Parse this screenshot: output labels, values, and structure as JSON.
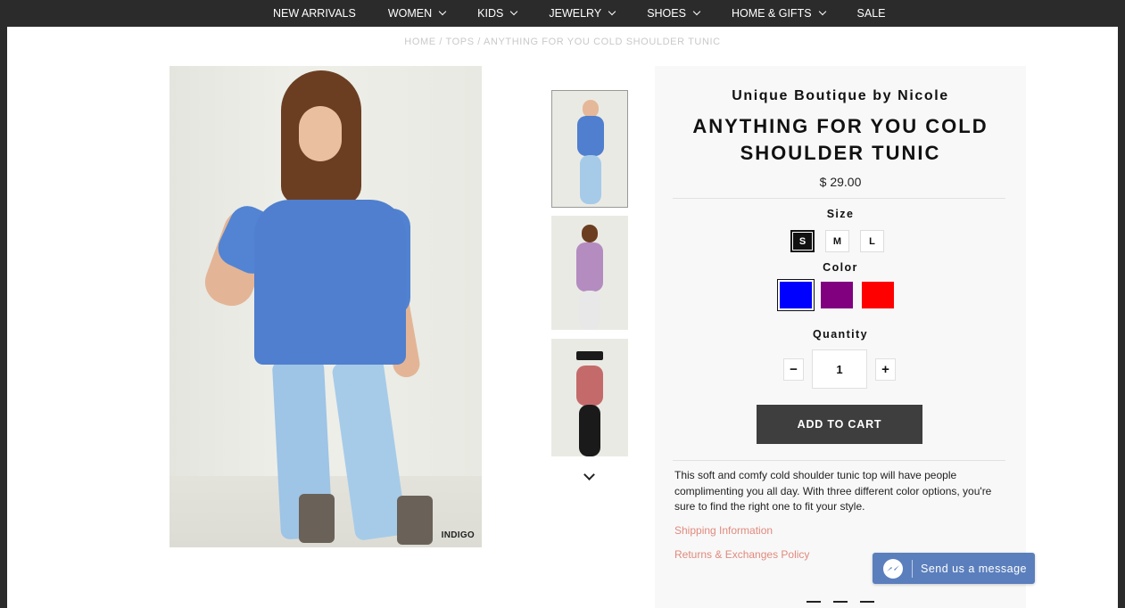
{
  "nav": {
    "items": [
      {
        "label": "NEW ARRIVALS",
        "has_dropdown": false
      },
      {
        "label": "WOMEN",
        "has_dropdown": true
      },
      {
        "label": "KIDS",
        "has_dropdown": true
      },
      {
        "label": "JEWELRY",
        "has_dropdown": true
      },
      {
        "label": "SHOES",
        "has_dropdown": true
      },
      {
        "label": "HOME & GIFTS",
        "has_dropdown": true
      },
      {
        "label": "SALE",
        "has_dropdown": false
      }
    ]
  },
  "breadcrumb": {
    "home": "HOME",
    "category": "TOPS",
    "current": "ANYTHING FOR YOU COLD SHOULDER TUNIC",
    "separator": " / "
  },
  "main_image": {
    "tag": "INDIGO"
  },
  "thumbnails": {
    "icons": [
      "thumbnail-indigo",
      "thumbnail-purple",
      "thumbnail-red"
    ],
    "down_icon": "chevron-down-icon"
  },
  "product": {
    "vendor": "Unique Boutique by Nicole",
    "title": "ANYTHING FOR YOU COLD SHOULDER TUNIC",
    "price": "$ 29.00",
    "size_label": "Size",
    "sizes": [
      "S",
      "M",
      "L"
    ],
    "selected_size": "S",
    "color_label": "Color",
    "colors": [
      "#0000ff",
      "#800080",
      "#ff0000"
    ],
    "selected_color": "#0000ff",
    "quantity_label": "Quantity",
    "quantity": "1",
    "minus": "−",
    "plus": "+",
    "add_to_cart": "ADD TO CART",
    "description": "This soft and comfy cold shoulder tunic top will have people complimenting you all day. With three different color options, you're sure to find the right one to fit your style.",
    "shipping_link": "Shipping Information",
    "returns_link": "Returns & Exchanges Policy"
  },
  "messenger": {
    "label": "Send us a message",
    "icon": "messenger-icon",
    "color": "#5b7fbd"
  }
}
